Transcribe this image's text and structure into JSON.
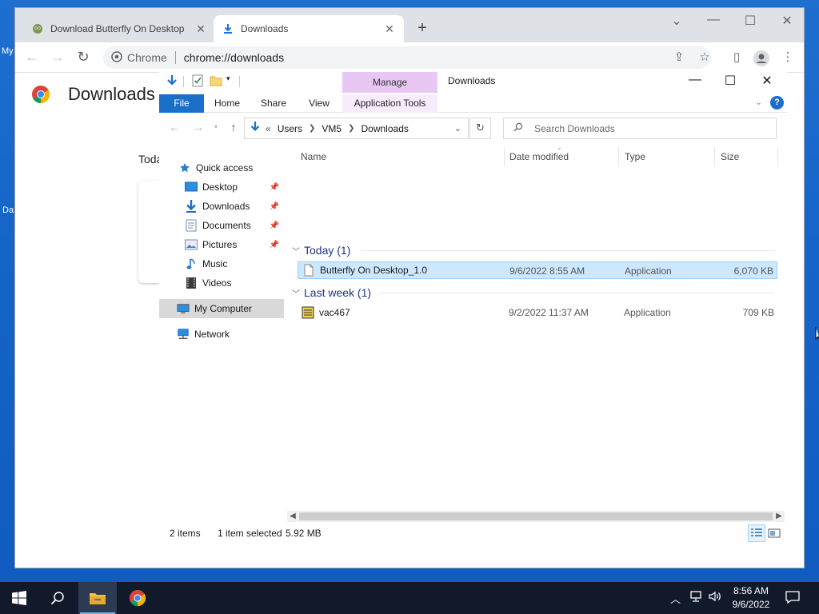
{
  "desktop": {
    "labels": [
      "My",
      "Da"
    ]
  },
  "chrome": {
    "tabs": [
      {
        "label": "Download Butterfly On Desktop",
        "close": "✕"
      },
      {
        "label": "Downloads",
        "close": "✕"
      }
    ],
    "new_tab": "+",
    "controls": {
      "dropdown": "⌄",
      "minimize": "—",
      "maximize": "☐",
      "close": "✕"
    },
    "omnibox": {
      "chip": "Chrome",
      "url": "chrome://downloads"
    },
    "page": {
      "title": "Downloads",
      "section": "Toda"
    }
  },
  "explorer": {
    "title": "Downloads",
    "ribbon": {
      "manage": "Manage",
      "tabs": [
        "File",
        "Home",
        "Share",
        "View",
        "Application Tools"
      ]
    },
    "breadcrumb": {
      "prefix": "«",
      "parts": [
        "Users",
        "VM5",
        "Downloads"
      ]
    },
    "search_placeholder": "Search Downloads",
    "nav": [
      {
        "label": "Quick access",
        "icon": "star-icon",
        "pinned": false
      },
      {
        "label": "Desktop",
        "icon": "desktop-folder-icon",
        "pinned": true
      },
      {
        "label": "Downloads",
        "icon": "downloads-folder-icon",
        "pinned": true
      },
      {
        "label": "Documents",
        "icon": "documents-folder-icon",
        "pinned": true
      },
      {
        "label": "Pictures",
        "icon": "pictures-folder-icon",
        "pinned": true
      },
      {
        "label": "Music",
        "icon": "music-folder-icon",
        "pinned": false
      },
      {
        "label": "Videos",
        "icon": "videos-folder-icon",
        "pinned": false
      },
      {
        "label": "My Computer",
        "icon": "computer-icon",
        "pinned": false
      },
      {
        "label": "Network",
        "icon": "network-icon",
        "pinned": false
      }
    ],
    "columns": [
      "Name",
      "Date modified",
      "Type",
      "Size"
    ],
    "groups": [
      {
        "label": "Today (1)",
        "files": [
          {
            "name": "Butterfly On Desktop_1.0",
            "date": "9/6/2022 8:55 AM",
            "type": "Application",
            "size": "6,070 KB",
            "selected": true
          }
        ]
      },
      {
        "label": "Last week (1)",
        "files": [
          {
            "name": "vac467",
            "date": "9/2/2022 11:37 AM",
            "type": "Application",
            "size": "709 KB",
            "selected": false
          }
        ]
      }
    ],
    "status": {
      "items": "2 items",
      "selected": "1 item selected",
      "size": "5.92 MB"
    }
  },
  "taskbar": {
    "time": "8:56 AM",
    "date": "9/6/2022"
  },
  "colors": {
    "file_tab": "#1a6fc9",
    "manage_tab": "#e9c7f5",
    "selection": "#cce8ff",
    "taskbar": "#101a2b",
    "desktop": "#1565c8"
  }
}
